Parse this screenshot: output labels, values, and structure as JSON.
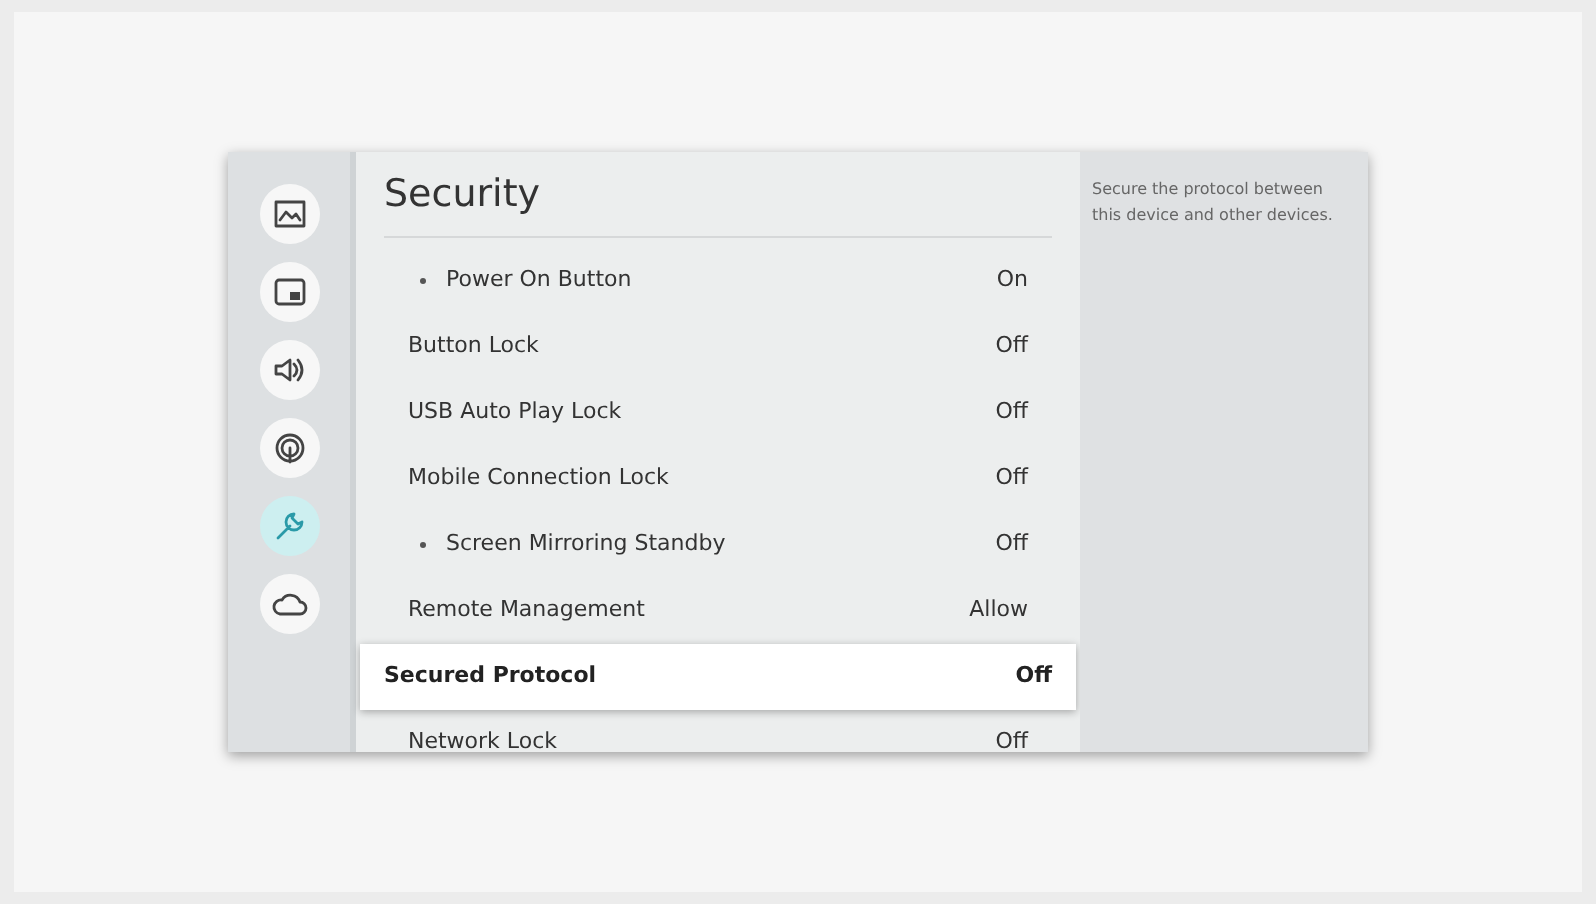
{
  "sidebar": {
    "items": [
      {
        "kind": "picture",
        "selected": false
      },
      {
        "kind": "pip",
        "selected": false
      },
      {
        "kind": "sound",
        "selected": false
      },
      {
        "kind": "broadcast",
        "selected": false
      },
      {
        "kind": "wrench",
        "selected": true
      },
      {
        "kind": "cloud",
        "selected": false
      }
    ]
  },
  "title": "Security",
  "rows": [
    {
      "kind": "sub",
      "label": "Power On Button",
      "value": "On",
      "selected": false
    },
    {
      "kind": "item",
      "label": "Button Lock",
      "value": "Off",
      "selected": false
    },
    {
      "kind": "item",
      "label": "USB Auto Play Lock",
      "value": "Off",
      "selected": false
    },
    {
      "kind": "item",
      "label": "Mobile Connection Lock",
      "value": "Off",
      "selected": false
    },
    {
      "kind": "sub",
      "label": "Screen Mirroring Standby",
      "value": "Off",
      "selected": false
    },
    {
      "kind": "item",
      "label": "Remote Management",
      "value": "Allow",
      "selected": false
    },
    {
      "kind": "item",
      "label": "Secured Protocol",
      "value": "Off",
      "selected": true
    },
    {
      "kind": "item",
      "label": "Network Lock",
      "value": "Off",
      "selected": false
    }
  ],
  "description": "Secure the protocol between this device and other devices."
}
